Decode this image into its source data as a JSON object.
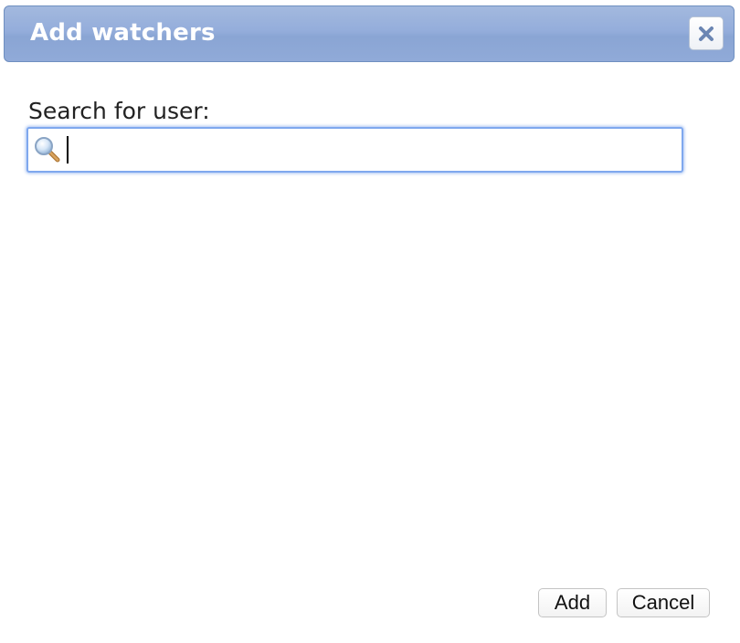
{
  "dialog": {
    "title": "Add watchers",
    "close_icon": "close-icon"
  },
  "search": {
    "label": "Search for user:",
    "value": "",
    "placeholder": "",
    "icon": "magnifier-icon"
  },
  "footer": {
    "add_label": "Add",
    "cancel_label": "Cancel"
  },
  "colors": {
    "titlebar": "#94addb",
    "focus_ring": "#7fa8ee",
    "close_x": "#6b86b3"
  }
}
